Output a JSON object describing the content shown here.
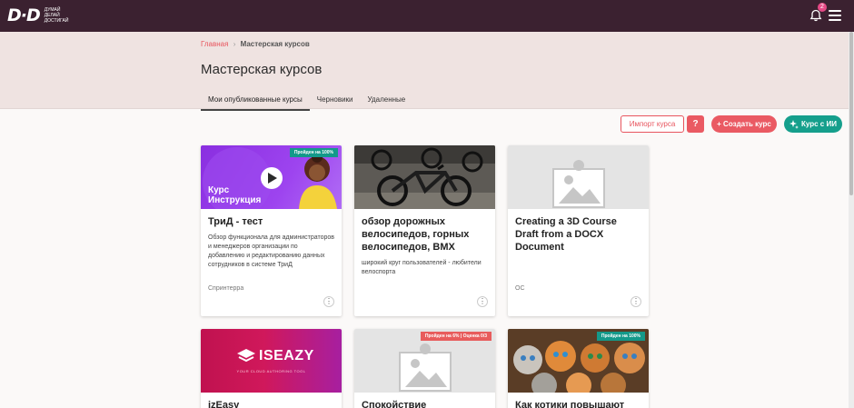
{
  "header": {
    "logo_mark": "D·D",
    "logo_lines": [
      "Думай",
      "делай",
      "достигай"
    ],
    "notifications_count": "2"
  },
  "breadcrumb": {
    "home": "Главная",
    "separator": "›",
    "current": "Мастерская курсов"
  },
  "page_title": "Мастерская курсов",
  "tabs": [
    {
      "label": "Мои опубликованные курсы",
      "active": true
    },
    {
      "label": "Черновики",
      "active": false
    },
    {
      "label": "Удаленные",
      "active": false
    }
  ],
  "actions": {
    "import_label": "Импорт курса",
    "help_label": "?",
    "create_label": "+ Создать курс",
    "ai_label": "Курс с ИИ"
  },
  "cards": [
    {
      "title": "ТриД - тест",
      "description": "Обзор функционала для администраторов и менеджеров организации по добавлению и редактированию данных сотрудников в системе ТриД",
      "author": "Спринтерра",
      "badge": "Пройден на 100%",
      "thumb_text": "Курс Инструкция"
    },
    {
      "title": "обзор дорожных велосипедов, горных велосипедов, BMX",
      "description": "широкий круг пользователей - любители велоспорта",
      "author": ""
    },
    {
      "title": "Creating a 3D Course Draft from a DOCX Document",
      "description": "",
      "author": "ОС"
    },
    {
      "title": "izEasy",
      "thumb_text": "ISEAZY",
      "thumb_sub": "YOUR CLOUD AUTHORING TOOL"
    },
    {
      "title": "Спокойствие",
      "badge": "Пройден на 6% | Оценка 0/3"
    },
    {
      "title": "Как котики повышают",
      "badge": "Пройден на 100%"
    }
  ],
  "more_label": "⋮"
}
